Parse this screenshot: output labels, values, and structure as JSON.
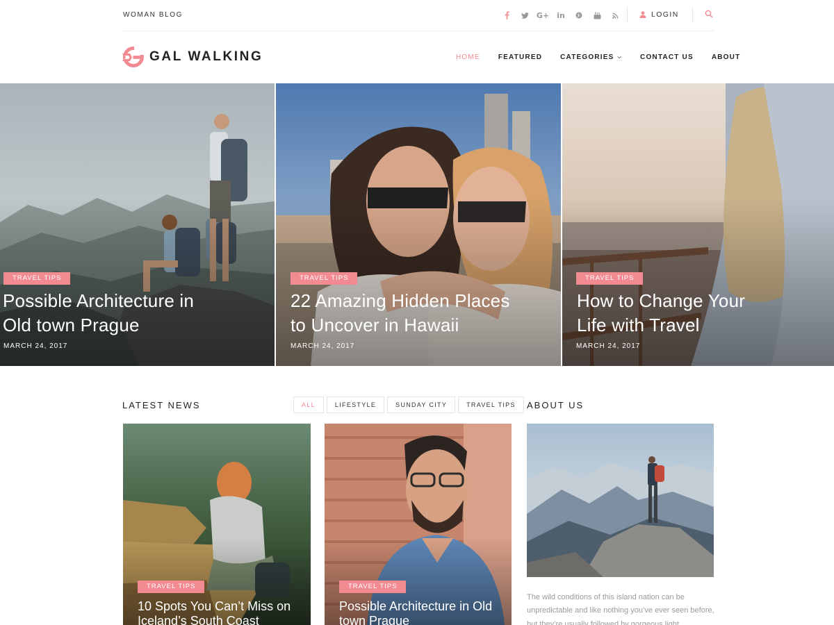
{
  "site": {
    "tagline": "WOMAN BLOG",
    "logo_text": "GAL WALKING",
    "login_label": "LOGIN",
    "accent_color": "#f28a92"
  },
  "social_icons": [
    "facebook-icon",
    "twitter-icon",
    "google-plus-icon",
    "linkedin-icon",
    "pinterest-icon",
    "youtube-icon",
    "rss-icon"
  ],
  "nav": [
    {
      "label": "HOME",
      "active": true
    },
    {
      "label": "FEATURED",
      "active": false
    },
    {
      "label": "CATEGORIES",
      "active": false,
      "has_dropdown": true
    },
    {
      "label": "CONTACT US",
      "active": false
    },
    {
      "label": "ABOUT",
      "active": false
    }
  ],
  "hero": [
    {
      "category": "TRAVEL TIPS",
      "title_lines": [
        "Possible Architecture in",
        "Old town Prague"
      ],
      "date": "MARCH 24, 2017"
    },
    {
      "category": "TRAVEL TIPS",
      "title_lines": [
        "22 Amazing Hidden Places",
        "to Uncover in Hawaii"
      ],
      "date": "MARCH 24, 2017"
    },
    {
      "category": "TRAVEL TIPS",
      "title_lines": [
        "How to Change Your",
        "Life with Travel"
      ],
      "date": "MARCH 24, 2017"
    }
  ],
  "latest": {
    "heading": "LATEST NEWS",
    "filters": [
      {
        "label": "ALL",
        "active": true
      },
      {
        "label": "LIFESTYLE",
        "active": false
      },
      {
        "label": "SUNDAY CITY",
        "active": false
      },
      {
        "label": "TRAVEL TIPS",
        "active": false
      }
    ],
    "posts": [
      {
        "category": "TRAVEL TIPS",
        "title": "10 Spots You Can’t Miss on Iceland’s South Coast"
      },
      {
        "category": "TRAVEL TIPS",
        "title": "Possible Architecture in Old town Prague"
      }
    ]
  },
  "about": {
    "heading": "ABOUT US",
    "text": "The wild conditions of this island nation can be unpredictable and like nothing you’ve ever seen before, but they’re usually followed by gorgeous light"
  }
}
